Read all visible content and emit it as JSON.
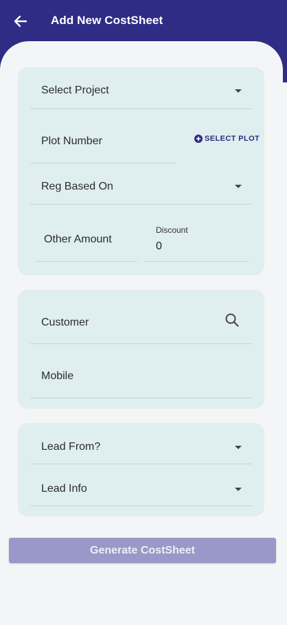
{
  "header": {
    "title": "Add New CostSheet",
    "back_icon": "arrow-left-icon"
  },
  "card1": {
    "select_project": "Select Project",
    "plot_number": "Plot Number",
    "select_plot": "SELECT PLOT",
    "reg_based_on": "Reg Based On",
    "other_amount": "Other Amount",
    "discount_label": "Discount",
    "discount_value": "0"
  },
  "card2": {
    "customer": "Customer",
    "mobile": "Mobile",
    "search_icon": "search-icon"
  },
  "card3": {
    "lead_from": "Lead From?",
    "lead_info": "Lead Info"
  },
  "action": {
    "generate": "Generate CostSheet"
  },
  "colors": {
    "primary": "#2f2c86",
    "card": "#dfeeee",
    "button_disabled": "#9a98c8"
  }
}
